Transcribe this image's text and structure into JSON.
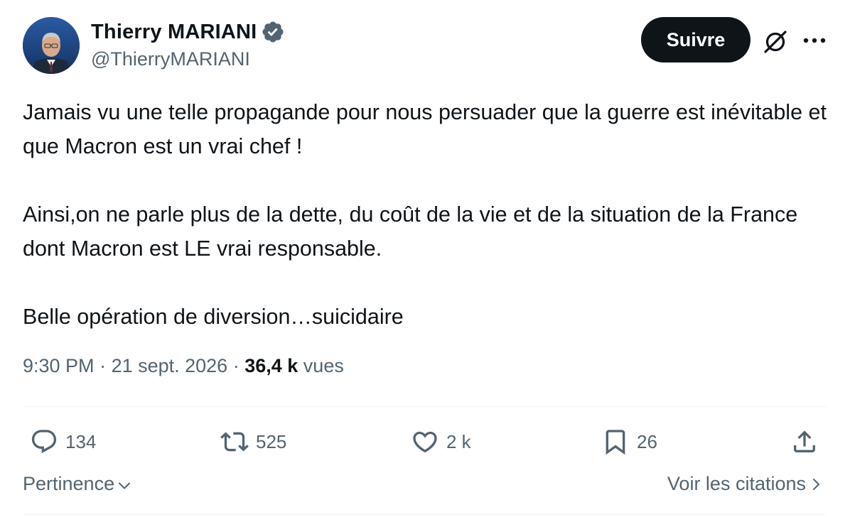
{
  "author": {
    "name": "Thierry MARIANI",
    "handle": "@ThierryMARIANI",
    "verified": true,
    "verified_color": "#536471"
  },
  "header": {
    "follow_label": "Suivre",
    "grok_icon": "grok-icon",
    "more_icon": "more-dots-icon"
  },
  "tweet": {
    "paragraphs": [
      "Jamais vu une telle propagande pour nous persuader que la guerre est inévitable et que Macron est un vrai chef !",
      "Ainsi,on ne parle plus de la dette, du coût de la vie et de la situation de la France dont Macron est LE vrai responsable.",
      "Belle opération de diversion…suicidaire"
    ]
  },
  "meta": {
    "time": "9:30 PM",
    "separator": " · ",
    "date": "21 sept. 2026",
    "views_count": "36,4 k",
    "views_label": "vues"
  },
  "actions": {
    "replies": "134",
    "reposts": "525",
    "likes": "2 k",
    "bookmarks": "26"
  },
  "footer": {
    "sort_label": "Pertinence",
    "quotes_label": "Voir les citations"
  },
  "colors": {
    "text": "#0f1419",
    "secondary": "#536471",
    "button_bg": "#0f1419",
    "divider": "#eff3f4"
  }
}
